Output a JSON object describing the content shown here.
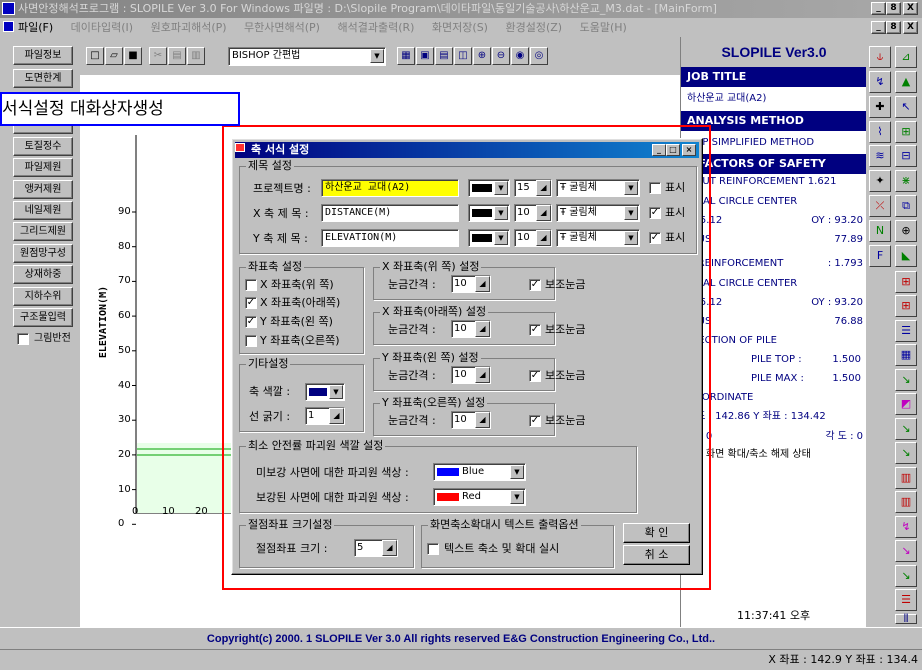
{
  "window": {
    "title": "사면안정해석프로그램 : SLOPILE Ver 3.0 For Windows 파일명 : D:\\Slopile Program\\데이타파일\\동일기술공사\\하산운교_M3.dat - [MainForm]",
    "controls": [
      "_",
      "8",
      "X"
    ]
  },
  "menu": [
    "파일(F)",
    "데이타입력(I)",
    "원호파괴해석(P)",
    "무한사면해석(P)",
    "해석결과출력(R)",
    "화면저장(S)",
    "환경설정(Z)",
    "도움말(H)"
  ],
  "left_buttons": [
    "파일정보",
    "도면한계",
    "",
    "",
    "토질정수",
    "파일제원",
    "앵커제원",
    "네일제원",
    "그리드제원",
    "원점망구성",
    "상재하중",
    "지하수위",
    "구조물입력"
  ],
  "left_checkbox": "그림반전",
  "toolbar": {
    "method_select": "BISHOP 간편법"
  },
  "plot": {
    "ylabel": "ELEVATION(M)",
    "y_ticks": [
      "90",
      "80",
      "70",
      "60",
      "50",
      "40",
      "30",
      "20",
      "10",
      "0"
    ],
    "x_ticks": [
      "0",
      "10",
      "20"
    ]
  },
  "right_panel": {
    "title": "SLOPILE Ver3.0",
    "job_title_head": "JOB TITLE",
    "job_title": "하산운교 교대(A2)",
    "analysis_head": "ANALYSIS METHOD",
    "analysis": "HOP SIMPLIFIED METHOD",
    "fs_head": "E FACTORS OF SAFETY",
    "without_label": "HOUT REINFORCEMENT",
    "without_value": "1.621",
    "critical1": "TICAL CIRCLE CENTER",
    "ox1": ": 45.12",
    "oy1": "OY : 93.20",
    "radius1_label": "DIUS",
    "radius1": "77.89",
    "with_label": "H REINFORCEMENT",
    "with_value": ": 1.793",
    "critical2": "TICAL CIRCLE CENTER",
    "ox2": ": 45.12",
    "oy2": "OY : 93.20",
    "radius2_label": "DIUS",
    "radius2": "76.88",
    "deflection": "FLECTION OF PILE",
    "piletop_label": "PILE TOP :",
    "piletop": "1.500",
    "pilemax_label": "PILE MAX :",
    "pilemax": "1.500",
    "coord_head": "COORDINATE",
    "coord": "좌표 : 142.86  Y 좌표 : 134.42",
    "ratio_label": "리 : 0",
    "angle_label": "각 도 : 0",
    "zoom_state": "재 : 화면 확대/축소 해제 상태",
    "clock": "11:37:41 오후"
  },
  "copyright": "Copyright(c) 2000. 1 SLOPILE Ver 3.0 All rights reserved E&G Construction Engineering Co., Ltd..",
  "status": "X 좌표 : 142.9 Y 좌표 : 134.4",
  "callout": "서식설정 대화상자생성",
  "dialog": {
    "title": "축 서식 설정",
    "title_group": "제목 설정",
    "project_label": "프로젝트명 :",
    "project_value": "하산운교 교대(A2)",
    "xaxis_label": "X 축 제 목 :",
    "xaxis_value": "DISTANCE(M)",
    "yaxis_label": "Y 축 제 목 :",
    "yaxis_value": "ELEVATION(M)",
    "size_project": "15",
    "size_x": "10",
    "size_y": "10",
    "font": "굴림체",
    "show_label": "표시",
    "axis_group": "좌표축 설정",
    "axis_items": [
      "X 좌표축(위  쪽)",
      "X 좌표축(아래쪽)",
      "Y 좌표축(왼  쪽)",
      "Y 좌표축(오른쪽)"
    ],
    "etc_group": "기타설정",
    "axis_color_label": "축 색깔 :",
    "line_width_label": "선 굵기 :",
    "line_width": "1",
    "x_top_group": "X 좌표축(위 쪽) 설정",
    "x_bottom_group": "X 좌표축(아래쪽) 설정",
    "y_left_group": "Y 좌표축(왼 쪽) 설정",
    "y_right_group": "Y 좌표축(오른쪽) 설정",
    "tick_interval_label": "눈금간격 :",
    "tick_value": "10",
    "minor_tick_label": "보조눈금",
    "circle_group": "최소 안전률 파괴원 색깔 설정",
    "unreinforced_label": "미보강 사면에 대한 파괴원 색상 :",
    "unreinforced_color": "Blue",
    "reinforced_label": "보강된 사면에 대한 파괴원 색상 :",
    "reinforced_color": "Red",
    "node_group": "절점좌표 크기설정",
    "node_label": "절점좌표 크기 :",
    "node_value": "5",
    "zoom_group": "화면축소확대시 텍스트 출력옵션",
    "zoom_check": "텍스트 축소 및 확대 실시",
    "ok": "확  인",
    "cancel": "취  소"
  },
  "colors": {
    "blue": "#0000ff",
    "red": "#ff0000",
    "navy": "#000080",
    "green": "#00a000"
  }
}
